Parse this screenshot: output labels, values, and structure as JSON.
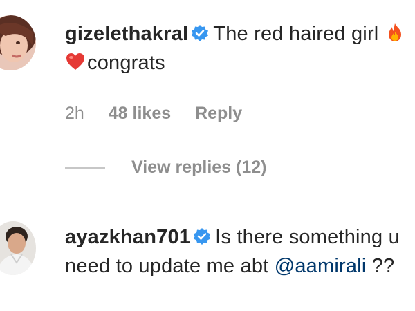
{
  "comments": [
    {
      "username": "gizelethakral",
      "verified": true,
      "text_before": "The red haired girl",
      "text_after": "congrats",
      "emojis": [
        "fire-emoji",
        "red-heart-emoji"
      ],
      "time": "2h",
      "likes": "48 likes",
      "reply_label": "Reply",
      "view_replies": "View replies (12)"
    },
    {
      "username": "ayazkhan701",
      "verified": true,
      "text_before": "Is there something u need to update me abt",
      "mention": "@aamirali",
      "text_after": "??"
    }
  ],
  "colors": {
    "verified": "#3897f0",
    "muted": "#8e8e8e",
    "mention": "#00376b",
    "text": "#262626"
  }
}
